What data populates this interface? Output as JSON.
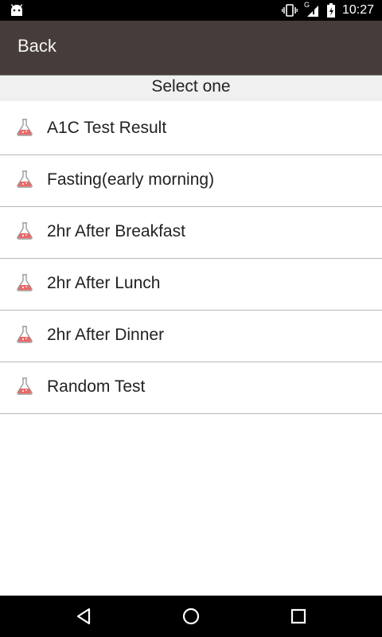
{
  "status_bar": {
    "time": "10:27",
    "network_label": "G",
    "icons": [
      "android-icon",
      "vibrate-icon",
      "signal-icon",
      "battery-icon"
    ]
  },
  "header": {
    "back_label": "Back"
  },
  "subheader": {
    "title": "Select one"
  },
  "list": {
    "items": [
      {
        "label": "A1C Test Result",
        "icon": "flask-icon"
      },
      {
        "label": "Fasting(early morning)",
        "icon": "flask-icon"
      },
      {
        "label": "2hr After Breakfast",
        "icon": "flask-icon"
      },
      {
        "label": "2hr After Lunch",
        "icon": "flask-icon"
      },
      {
        "label": "2hr After Dinner",
        "icon": "flask-icon"
      },
      {
        "label": "Random Test",
        "icon": "flask-icon"
      }
    ]
  },
  "nav_bar": {
    "icons": [
      "back-nav-icon",
      "home-nav-icon",
      "recents-nav-icon"
    ]
  },
  "colors": {
    "app_bar": "#463d3b",
    "subheader_bg": "#f0f0f0",
    "divider": "#b9b5b6",
    "flask_liquid": "#e86a6a"
  }
}
